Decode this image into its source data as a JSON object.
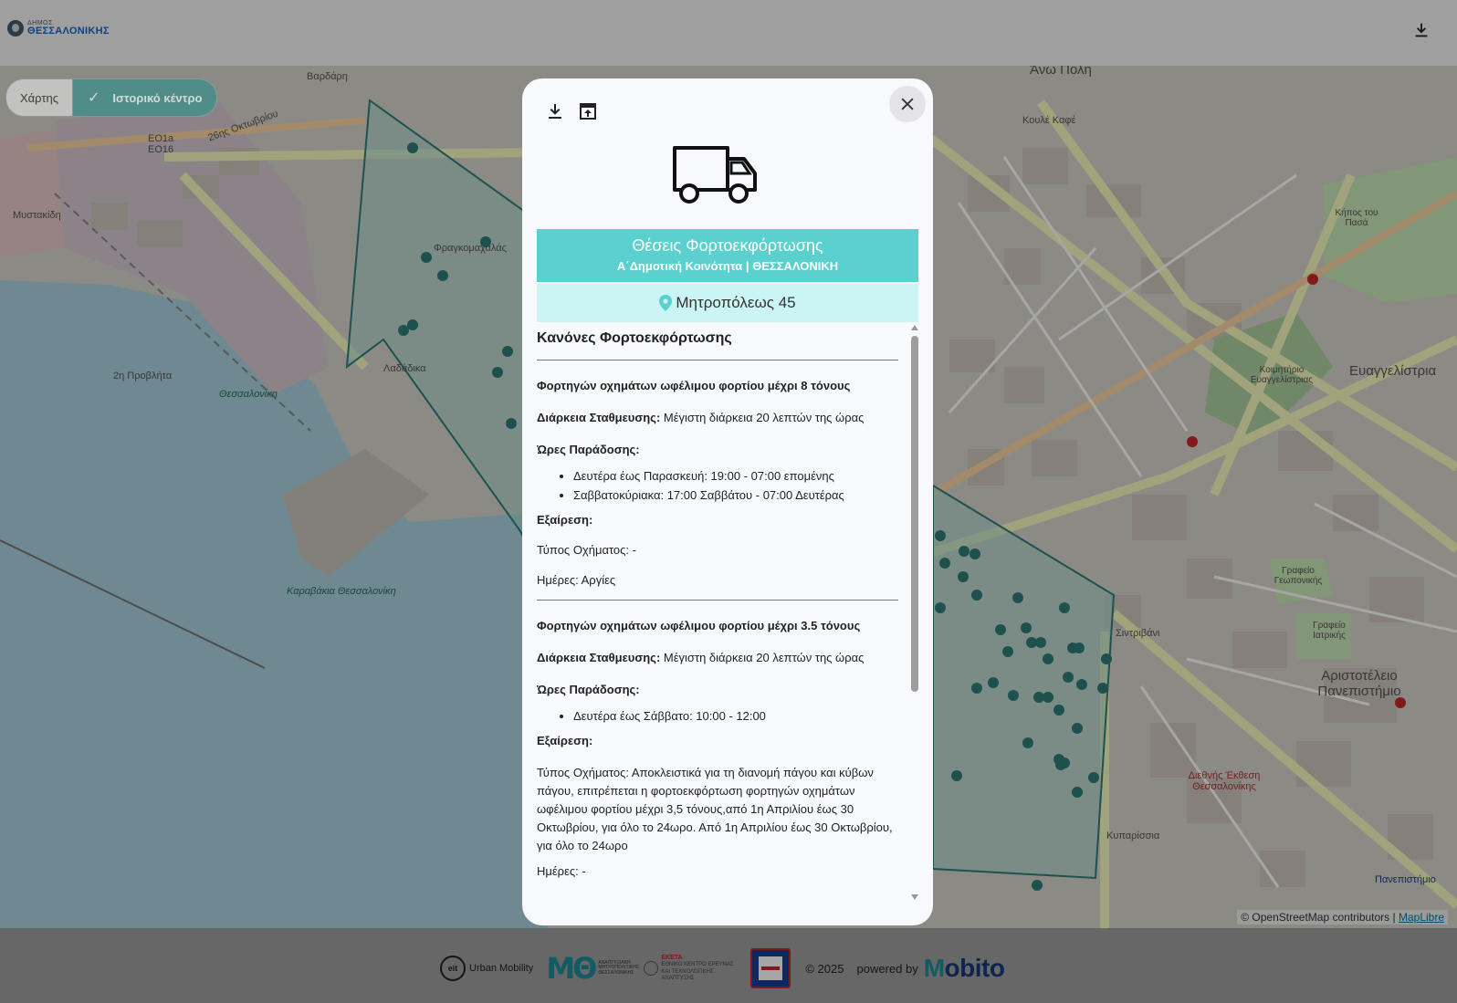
{
  "header": {
    "logo_small": "ΔΗΜΟΣ",
    "logo_big": "ΘΕΣΣΑΛΟΝΙΚΗΣ",
    "download_icon": "download-icon"
  },
  "toggle": {
    "map_label": "Χάρτης",
    "center_label": "Ιστορικό κέντρο",
    "active": "Ιστορικό κέντρο"
  },
  "map": {
    "labels": [
      "Βαρδάρη",
      "26ης Οκτωβρίου",
      "EO1a",
      "EO16",
      "Μυστακίδη",
      "2η Προβλήτα",
      "Θεσσαλονίκη",
      "Λαδάδικα",
      "Φραγκομαχαλάς",
      "Καραβάκια Θεσσαλονίκη",
      "Άνω Πόλη",
      "Κουλέ Καφέ",
      "Ευαγγελίστρια",
      "Αριστοτέλειο Πανεπιστήμιο",
      "Σιντριβάνι",
      "Πανεπιστήμιο",
      "Διεθνής Έκθεση Θεσσαλονίκης",
      "Κυπαρίσσια",
      "Κήπος του Πασά",
      "Γραφείο Γεωπονικής",
      "Γραφείο Ιατρικής",
      "Κοιμητήριο Ευαγγελίστριας"
    ],
    "attribution_text": "© OpenStreetMap contributors | ",
    "attribution_link": "MapLibre"
  },
  "modal": {
    "download_icon": "download-icon",
    "share_icon": "open-in-new-icon",
    "close_icon": "close-icon",
    "truck_icon": "truck-icon",
    "title": "Θέσεις Φορτοεκφόρτωσης",
    "subtitle": "Α΄Δημοτική Κοινότητα | ΘΕΣΣΑΛΟΝΙΚΗ",
    "address": "Μητροπόλεως 45",
    "rules_heading": "Κανόνες Φορτοεκφόρτωσης",
    "rules": [
      {
        "category": "Φορτηγών οχημάτων ωφέλιμου φορτίου μέχρι 8 τόνους",
        "duration_label": "Διάρκεια Σταθμευσης:",
        "duration_value": "Μέγιστη διάρκεια 20 λεπτών της ώρας",
        "hours_label": "Ώρες Παράδοσης:",
        "hours": [
          "Δευτέρα έως Παρασκευή: 19:00 - 07:00 επομένης",
          "Σαββατοκύριακα: 17:00 Σαββάτου - 07:00 Δευτέρας"
        ],
        "exception_label": "Εξαίρεση:",
        "vehicle_type": "Τύπος Οχήματος: -",
        "days": "Ημέρες: Αργίες"
      },
      {
        "category": "Φορτηγών οχημάτων ωφέλιμου φορτίου μέχρι 3.5 τόνους",
        "duration_label": "Διάρκεια Σταθμευσης:",
        "duration_value": "Μέγιστη διάρκεια 20 λεπτών της ώρας",
        "hours_label": "Ώρες Παράδοσης:",
        "hours": [
          "Δευτέρα έως Σάββατο: 10:00 - 12:00"
        ],
        "exception_label": "Εξαίρεση:",
        "vehicle_type": "Τύπος Οχήματος: Αποκλειστικά για τη διανομή πάγου και κύβων πάγου, επιτρέπεται η φορτοεκφόρτωση φορτηγών οχημάτων ωφέλιμου φορτίου μέχρι 3,5 τόνους,από 1η Απριλίου έως 30 Οκτωβρίου, για όλο το 24ωρο. Από 1η Απριλίου έως 30 Οκτωβρίου, για όλο το 24ωρο",
        "days": "Ημέρες: -"
      }
    ]
  },
  "footer": {
    "eit_mark": "eit",
    "eit_text": "Urban Mobility",
    "mth_text": "ΑΝΑΠΤΥΞΙΑΚΗ ΜΗΤΡΟΠΟΛΙΤΙΚΗΣ ΘΕΣΣΑΛΟΝΙΚΗΣ",
    "ekete_title": "ΕΚΕΤΑ",
    "ekete_text": "ΕΘΝΙΚΟ ΚΕΝΤΡΟ ΕΡΕΥΝΑΣ ΚΑΙ ΤΕΧΝΟΛΟΓΙΚΗΣ ΑΝΑΠΤΥΞΗΣ",
    "copyright": "© 2025",
    "powered_by": "powered by",
    "brand_first": "M",
    "brand_rest": "obito"
  },
  "colors": {
    "accent": "#5bd1cf",
    "accent_light": "#cbf5f4",
    "toggle_active": "#3d8f8a",
    "zone_outline": "#2e7f7a",
    "zone_marker": "#2f7d77"
  }
}
